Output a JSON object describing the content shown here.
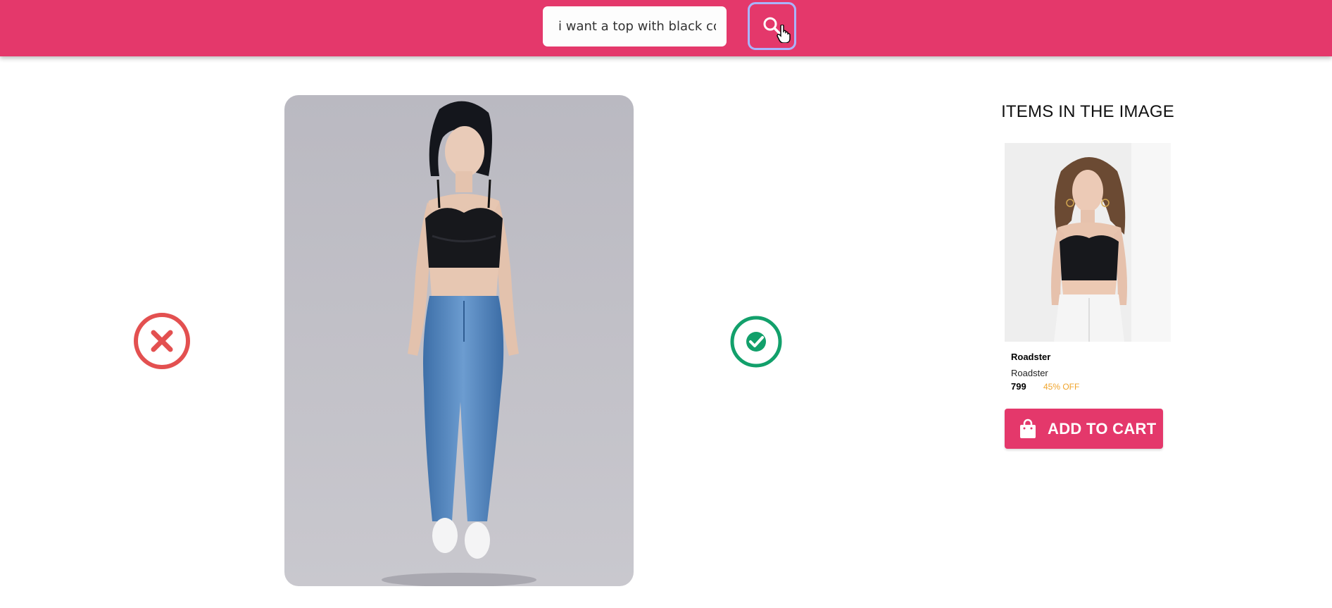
{
  "search": {
    "value": "i want a top with black co",
    "icon": "search-icon"
  },
  "actions": {
    "reject_icon": "close-icon",
    "accept_icon": "check-icon",
    "reject_color": "#e35050",
    "accept_color": "#12a06b"
  },
  "sidebar": {
    "title": "ITEMS IN THE IMAGE",
    "product": {
      "brand": "Roadster",
      "name": "Roadster",
      "price": "799",
      "discount": "45% OFF"
    },
    "add_to_cart_label": "ADD TO CART",
    "cart_icon": "shopping-bag-icon"
  },
  "colors": {
    "brand": "#e4386b",
    "discount": "#f0a42c"
  }
}
